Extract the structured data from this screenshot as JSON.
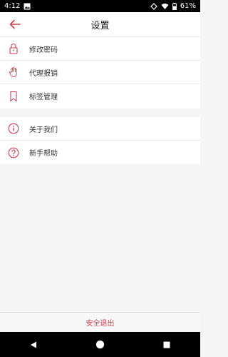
{
  "status_bar": {
    "time": "4:12",
    "battery": "61%",
    "icons": [
      "image-icon",
      "wifi-icon",
      "signal-icon",
      "battery-icon"
    ]
  },
  "app_bar": {
    "title": "设置",
    "back_icon": "arrow-left-icon",
    "accent": "#c7434f"
  },
  "menu_group_1": [
    {
      "label": "修改密码",
      "icon": "lock-icon"
    },
    {
      "label": "代理报销",
      "icon": "hand-icon"
    },
    {
      "label": "标签管理",
      "icon": "bookmark-icon"
    }
  ],
  "menu_group_2": [
    {
      "label": "关于我们",
      "icon": "info-icon"
    },
    {
      "label": "新手帮助",
      "icon": "help-icon"
    }
  ],
  "footer": {
    "logout_label": "安全退出"
  },
  "nav_bar": {
    "icons": [
      "back-triangle-icon",
      "home-circle-icon",
      "recents-square-icon"
    ]
  }
}
